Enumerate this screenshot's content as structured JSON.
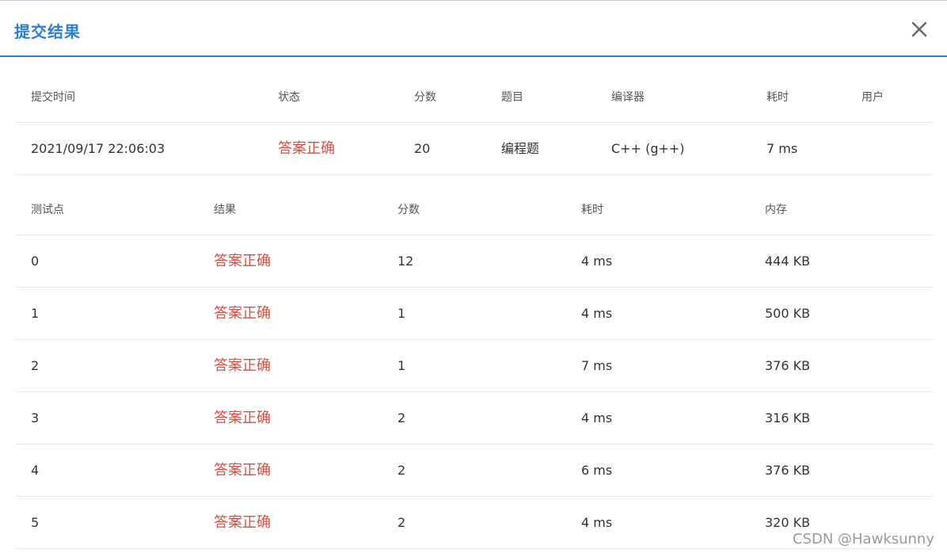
{
  "dialog": {
    "title": "提交结果",
    "close_icon": "close-icon"
  },
  "summary": {
    "headers": [
      "提交时间",
      "状态",
      "分数",
      "题目",
      "编译器",
      "耗时",
      "用户"
    ],
    "row": {
      "time": "2021/09/17 22:06:03",
      "status": "答案正确",
      "score": "20",
      "problem": "编程题",
      "compiler": "C++ (g++)",
      "duration": "7 ms",
      "user": ""
    }
  },
  "cases": {
    "headers": [
      "测试点",
      "结果",
      "分数",
      "耗时",
      "内存"
    ],
    "rows": [
      {
        "id": "0",
        "result": "答案正确",
        "score": "12",
        "time": "4 ms",
        "memory": "444 KB"
      },
      {
        "id": "1",
        "result": "答案正确",
        "score": "1",
        "time": "4 ms",
        "memory": "500 KB"
      },
      {
        "id": "2",
        "result": "答案正确",
        "score": "1",
        "time": "7 ms",
        "memory": "376 KB"
      },
      {
        "id": "3",
        "result": "答案正确",
        "score": "2",
        "time": "4 ms",
        "memory": "316 KB"
      },
      {
        "id": "4",
        "result": "答案正确",
        "score": "2",
        "time": "6 ms",
        "memory": "376 KB"
      },
      {
        "id": "5",
        "result": "答案正确",
        "score": "2",
        "time": "4 ms",
        "memory": "320 KB"
      }
    ]
  },
  "colors": {
    "accent": "#2d7fd3",
    "success_text": "#e04a3f"
  },
  "watermark": "CSDN @Hawksunny"
}
